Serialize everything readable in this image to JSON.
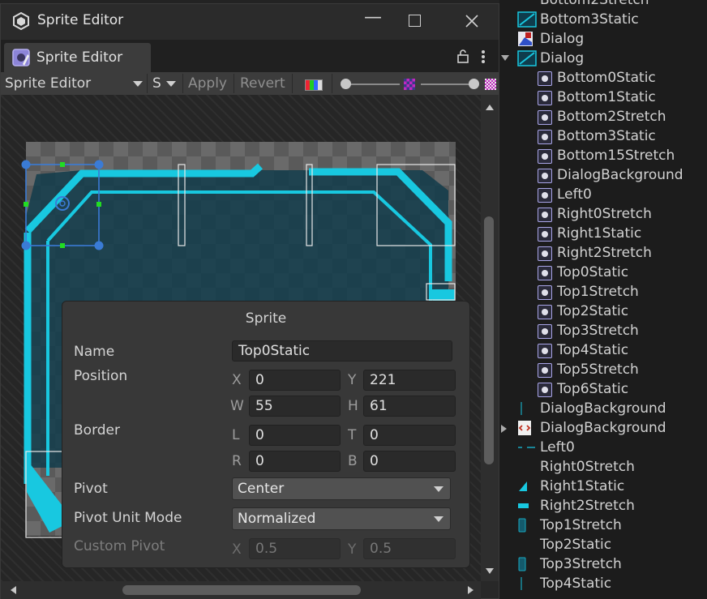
{
  "window": {
    "title": "Sprite Editor",
    "tab_label": "Sprite Editor"
  },
  "toolbar": {
    "mode_label": "Sprite Editor",
    "s_label": "S",
    "apply_label": "Apply",
    "revert_label": "Revert",
    "zoom_level": 0.93,
    "mip_level": 0.04
  },
  "sprite_panel": {
    "title": "Sprite",
    "name_label": "Name",
    "name_value": "Top0Static",
    "position_label": "Position",
    "x_label": "X",
    "x_value": "0",
    "y_label": "Y",
    "y_value": "221",
    "w_label": "W",
    "w_value": "55",
    "h_label": "H",
    "h_value": "61",
    "border_label": "Border",
    "l_label": "L",
    "l_value": "0",
    "t_label": "T",
    "t_value": "0",
    "r_label": "R",
    "r_value": "0",
    "b_label": "B",
    "b_value": "0",
    "pivot_label": "Pivot",
    "pivot_value": "Center",
    "pivot_unit_label": "Pivot Unit Mode",
    "pivot_unit_value": "Normalized",
    "custom_pivot_label": "Custom Pivot",
    "cx_label": "X",
    "cx_value": "0.5",
    "cy_label": "Y",
    "cy_value": "0.5"
  },
  "project_tree": {
    "partial_top": "Bottom2Stretch",
    "items": [
      {
        "label": "Bottom3Static",
        "icon": "texture-icon"
      },
      {
        "label": "Dialog",
        "icon": "image-icon"
      },
      {
        "label": "Dialog",
        "icon": "texture-icon"
      },
      {
        "label": "Bottom0Static",
        "icon": "sprite-icon"
      },
      {
        "label": "Bottom1Static",
        "icon": "sprite-icon"
      },
      {
        "label": "Bottom2Stretch",
        "icon": "sprite-icon"
      },
      {
        "label": "Bottom3Static",
        "icon": "sprite-icon"
      },
      {
        "label": "Bottom15Stretch",
        "icon": "sprite-icon"
      },
      {
        "label": "DialogBackground",
        "icon": "sprite-icon"
      },
      {
        "label": "Left0",
        "icon": "sprite-icon"
      },
      {
        "label": "Right0Stretch",
        "icon": "sprite-icon"
      },
      {
        "label": "Right1Static",
        "icon": "sprite-icon"
      },
      {
        "label": "Right2Stretch",
        "icon": "sprite-icon"
      },
      {
        "label": "Top0Static",
        "icon": "sprite-icon"
      },
      {
        "label": "Top1Stretch",
        "icon": "sprite-icon"
      },
      {
        "label": "Top2Static",
        "icon": "sprite-icon"
      },
      {
        "label": "Top3Stretch",
        "icon": "sprite-icon"
      },
      {
        "label": "Top4Static",
        "icon": "sprite-icon"
      },
      {
        "label": "Top5Stretch",
        "icon": "sprite-icon"
      },
      {
        "label": "Top6Static",
        "icon": "sprite-icon"
      },
      {
        "label": "DialogBackground",
        "icon": "thin-line-icon"
      },
      {
        "label": "DialogBackground",
        "icon": "code-icon"
      },
      {
        "label": "Left0",
        "icon": "dash-icon"
      },
      {
        "label": "Right0Stretch",
        "icon": "blank-icon"
      },
      {
        "label": "Right1Static",
        "icon": "corner-icon"
      },
      {
        "label": "Right2Stretch",
        "icon": "bar-icon"
      },
      {
        "label": "Top1Stretch",
        "icon": "cylinder-icon"
      },
      {
        "label": "Top2Static",
        "icon": "blank-icon"
      },
      {
        "label": "Top3Stretch",
        "icon": "cylinder-icon"
      },
      {
        "label": "Top4Static",
        "icon": "thin-line-icon"
      }
    ]
  },
  "colors": {
    "accent_cyan": "#18c8e0",
    "sprite_icon_border": "#a9a5e8",
    "selection_blue": "#3a7bd5",
    "handle_green": "#22dd22"
  }
}
